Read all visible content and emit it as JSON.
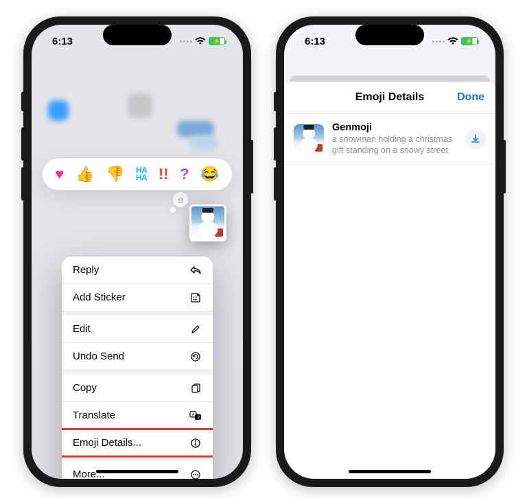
{
  "status": {
    "time": "6:13"
  },
  "tapbacks": [
    "❤️",
    "👍",
    "👎",
    "HA HA",
    "‼️",
    "?",
    "😂"
  ],
  "context_menu": {
    "groups": [
      [
        "Reply",
        "Add Sticker"
      ],
      [
        "Edit",
        "Undo Send"
      ],
      [
        "Copy",
        "Translate",
        "Emoji Details..."
      ],
      [
        "More..."
      ]
    ],
    "highlighted": "Emoji Details..."
  },
  "sheet": {
    "title": "Emoji Details",
    "done": "Done",
    "item": {
      "name": "Genmoji",
      "description": "a snowman holding a christmas gift standing on a snowy street"
    }
  }
}
